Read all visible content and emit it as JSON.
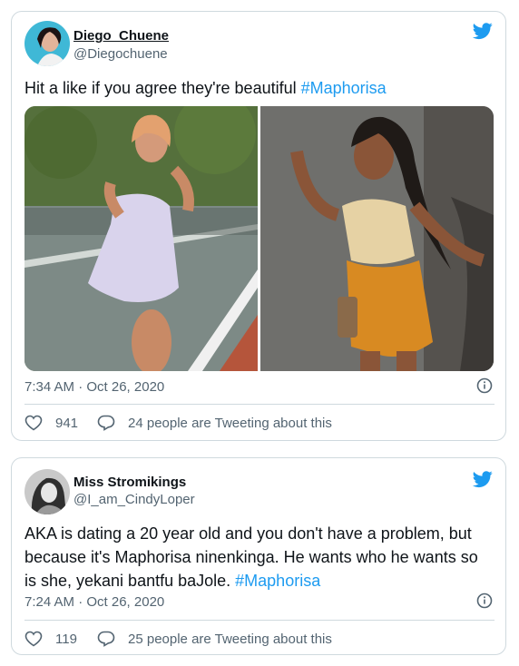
{
  "tweets": [
    {
      "display_name": "Diego_Chuene",
      "handle": "@Diegochuene",
      "text": "Hit a like if you agree they're beautiful ",
      "hashtag": "#Maphorisa",
      "timestamp": "7:34 AM · Oct 26, 2020",
      "likes": "941",
      "replies_label": "24 people are Tweeting about this"
    },
    {
      "display_name": "Miss Stromikings",
      "handle": "@I_am_CindyLoper",
      "text": "AKA is dating a 20 year old and you don't have a problem, but because it's Maphorisa ninenkinga. He wants who he wants so is she, yekani bantfu baJole. ",
      "hashtag": "#Maphorisa",
      "timestamp": "7:24 AM · Oct 26, 2020",
      "likes": "119",
      "replies_label": "25 people are Tweeting about this"
    }
  ],
  "colors": {
    "brand": "#1d9bf0",
    "border": "#cfd9de",
    "muted": "#536471"
  }
}
